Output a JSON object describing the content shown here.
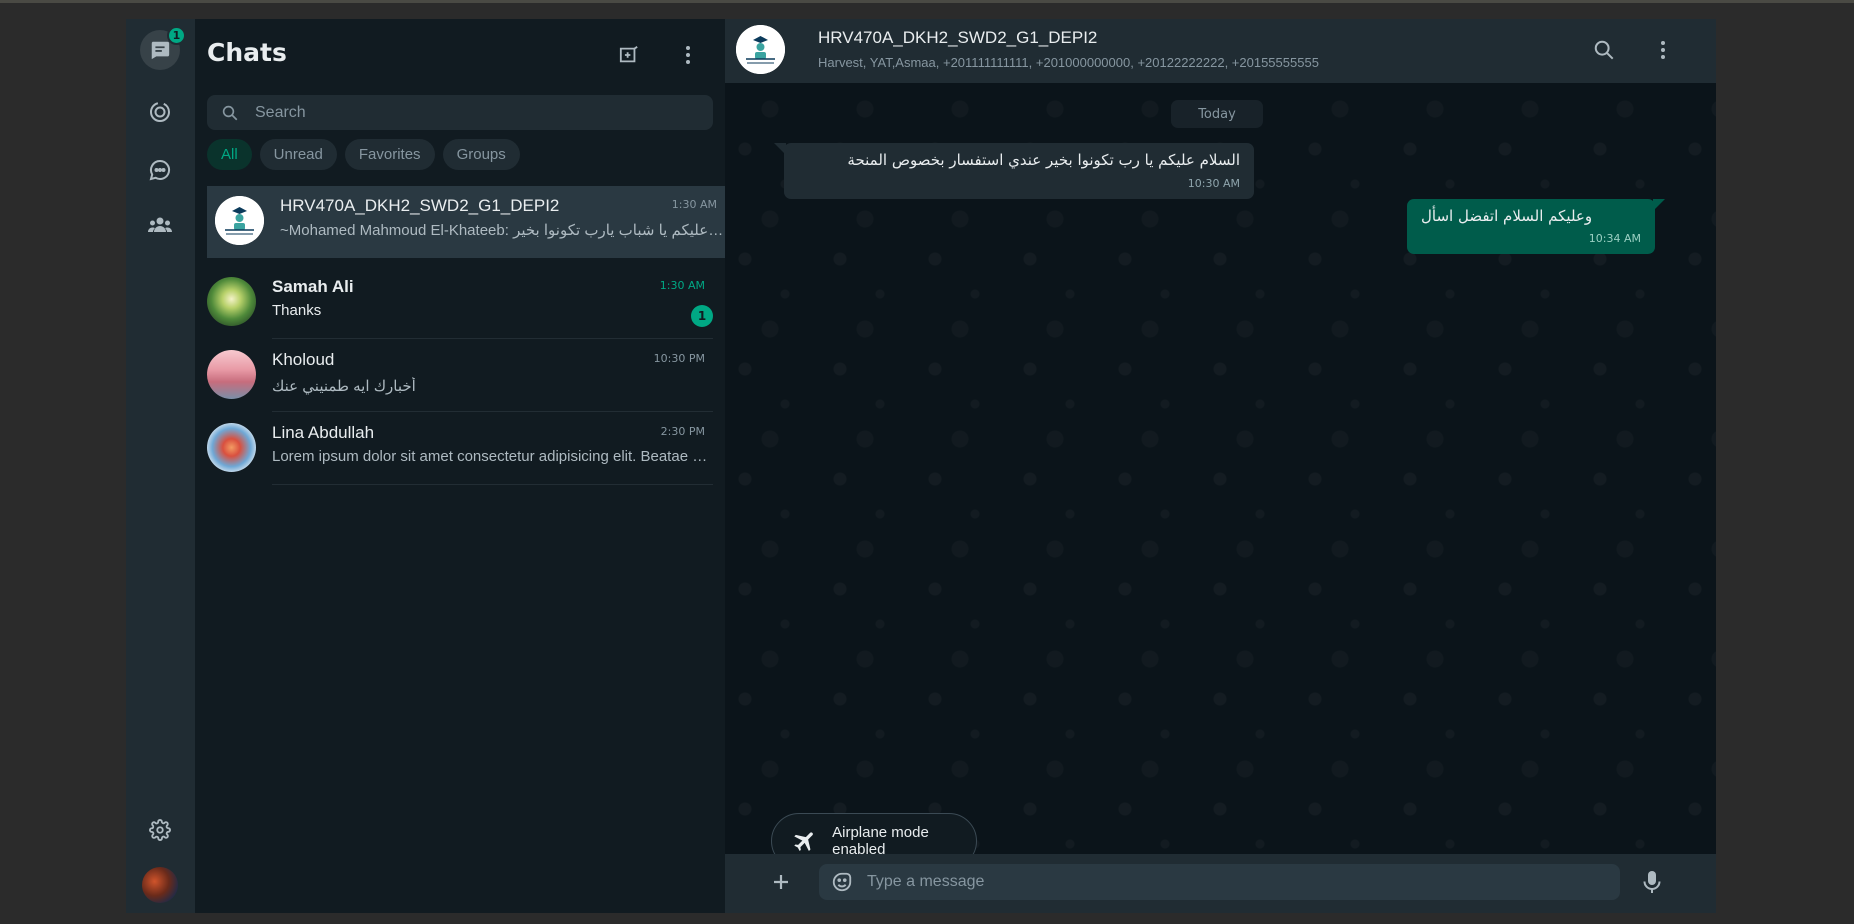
{
  "rail": {
    "chats_badge": "1",
    "icons": [
      "chats-icon",
      "status-icon",
      "channels-icon",
      "communities-icon",
      "settings-icon"
    ]
  },
  "chat_list": {
    "title": "Chats",
    "search_placeholder": "Search",
    "filters": [
      "All",
      "Unread",
      "Favorites",
      "Groups"
    ],
    "active_filter": "All",
    "chats": [
      {
        "name": "HRV470A_DKH2_SWD2_G1_DEPI2",
        "time": "1:30 AM",
        "preview": "~Mohamed Mahmoud El-Khateeb: السلام عليكم يا شباب يارب تكونوا بخير",
        "selected": true
      },
      {
        "name": "Samah Ali",
        "time": "1:30 AM",
        "preview": "Thanks",
        "unread": "1"
      },
      {
        "name": "Kholoud",
        "time": "10:30 PM",
        "preview": "أخبارك ايه طمنيني عنك"
      },
      {
        "name": "Lina Abdullah",
        "time": "2:30 PM",
        "preview": "Lorem ipsum dolor sit amet consectetur adipisicing elit. Beatae veniam"
      }
    ]
  },
  "conversation": {
    "title": "HRV470A_DKH2_SWD2_G1_DEPI2",
    "subtitle": "Harvest, YAT,Asmaa, +201111111111, +201000000000, +20122222222, +20155555555",
    "date_label": "Today",
    "messages": [
      {
        "direction": "in",
        "text": "السلام عليكم يا رب تكونوا بخير عندي استفسار بخصوص المنحة",
        "time": "10:30 AM"
      },
      {
        "direction": "out",
        "text": "وعليكم السلام اتفضل اسأل",
        "time": "10:34 AM"
      }
    ],
    "composer_placeholder": "Type a message"
  },
  "toast": {
    "text": "Airplane mode enabled"
  },
  "colors": {
    "accent": "#00a884",
    "outgoing_bubble": "#005c4b",
    "panel": "#202c33",
    "background": "#111b21"
  }
}
